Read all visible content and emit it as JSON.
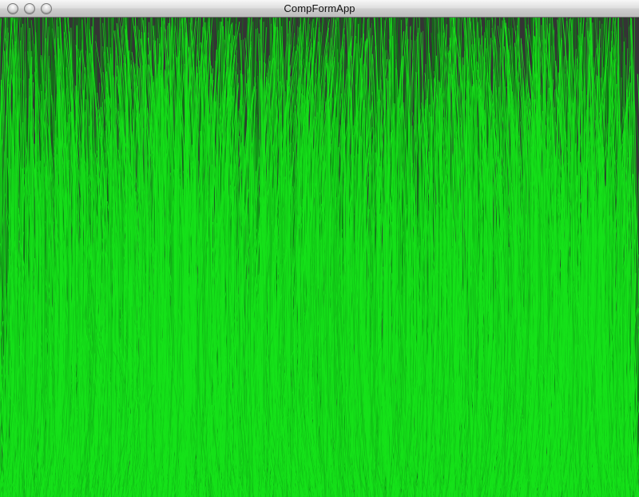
{
  "window": {
    "title": "CompFormApp"
  },
  "traffic_lights": {
    "close": "close-button",
    "minimize": "minimize-button",
    "zoom": "zoom-button"
  },
  "canvas": {
    "background_color": "#343434",
    "blade_color_primary": "#16e21a",
    "blade_color_dark": "#0b7f11",
    "blade_color_mid": "#12bf17",
    "description": ""
  }
}
